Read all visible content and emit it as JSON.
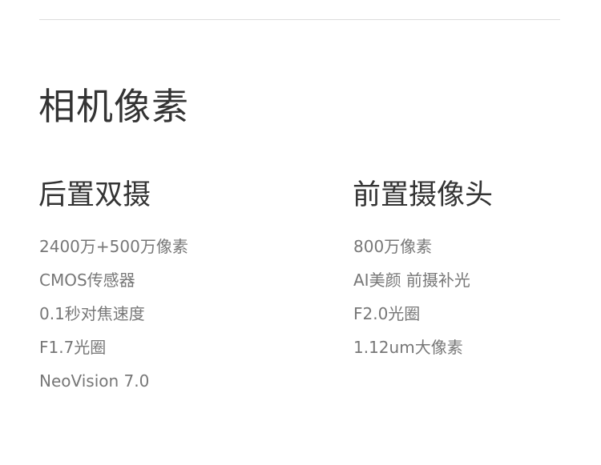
{
  "section": {
    "title": "相机像素"
  },
  "rear": {
    "title": "后置双摄",
    "items": [
      "2400万+500万像素",
      "CMOS传感器",
      "0.1秒对焦速度",
      "F1.7光圈",
      "NeoVision 7.0"
    ]
  },
  "front": {
    "title": "前置摄像头",
    "items": [
      "800万像素",
      "AI美颜 前摄补光",
      "F2.0光圈",
      "1.12um大像素"
    ]
  }
}
